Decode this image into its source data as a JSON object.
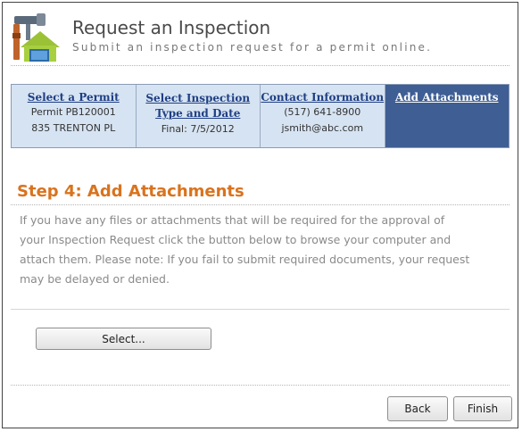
{
  "header": {
    "title": "Request an Inspection",
    "subtitle": "Submit an inspection request for a permit online.",
    "icon": "tools-house-icon"
  },
  "steps": [
    {
      "title": "Select a Permit",
      "lines": [
        "Permit PB120001",
        "835 TRENTON PL"
      ],
      "active": false
    },
    {
      "title_lines": [
        "Select Inspection",
        "Type and Date"
      ],
      "lines": [
        "Final: 7/5/2012"
      ],
      "active": false
    },
    {
      "title": "Contact Information",
      "lines": [
        "(517) 641-8900",
        "jsmith@abc.com"
      ],
      "active": false
    },
    {
      "title": "Add Attachments",
      "lines": [],
      "active": true
    }
  ],
  "main": {
    "heading": "Step 4: Add Attachments",
    "instructions": [
      "If you have any files or attachments that will be required for the approval of",
      "your Inspection Request click the button below to browse your computer and",
      "attach them. Please note: If you fail to submit required documents, your request",
      "may be delayed or denied."
    ],
    "select_label": "Select..."
  },
  "footer": {
    "back_label": "Back",
    "finish_label": "Finish"
  },
  "colors": {
    "heading": "#d9731e",
    "step_bg": "#d6e3f2",
    "step_active_bg": "#3e5e94",
    "step_link": "#1f3f84"
  }
}
